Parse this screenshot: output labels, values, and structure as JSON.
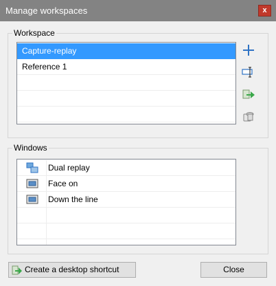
{
  "window": {
    "title": "Manage workspaces",
    "close_glyph": "x"
  },
  "workspace": {
    "group_label": "Workspace",
    "items": [
      {
        "label": "Capture-replay",
        "selected": true
      },
      {
        "label": "Reference 1",
        "selected": false
      }
    ],
    "actions": [
      {
        "name": "add-workspace-icon"
      },
      {
        "name": "rename-workspace-icon"
      },
      {
        "name": "load-workspace-icon"
      },
      {
        "name": "delete-workspace-icon"
      }
    ]
  },
  "windows": {
    "group_label": "Windows",
    "items": [
      {
        "label": "Dual replay",
        "icon": "dual-replay-icon"
      },
      {
        "label": "Face on",
        "icon": "screen-icon"
      },
      {
        "label": "Down the line",
        "icon": "screen-icon"
      }
    ]
  },
  "buttons": {
    "shortcut_label": "Create a desktop shortcut",
    "close_label": "Close"
  },
  "colors": {
    "selection": "#3399ff",
    "accent_blue": "#2f73c4",
    "close_red": "#c0392b"
  }
}
